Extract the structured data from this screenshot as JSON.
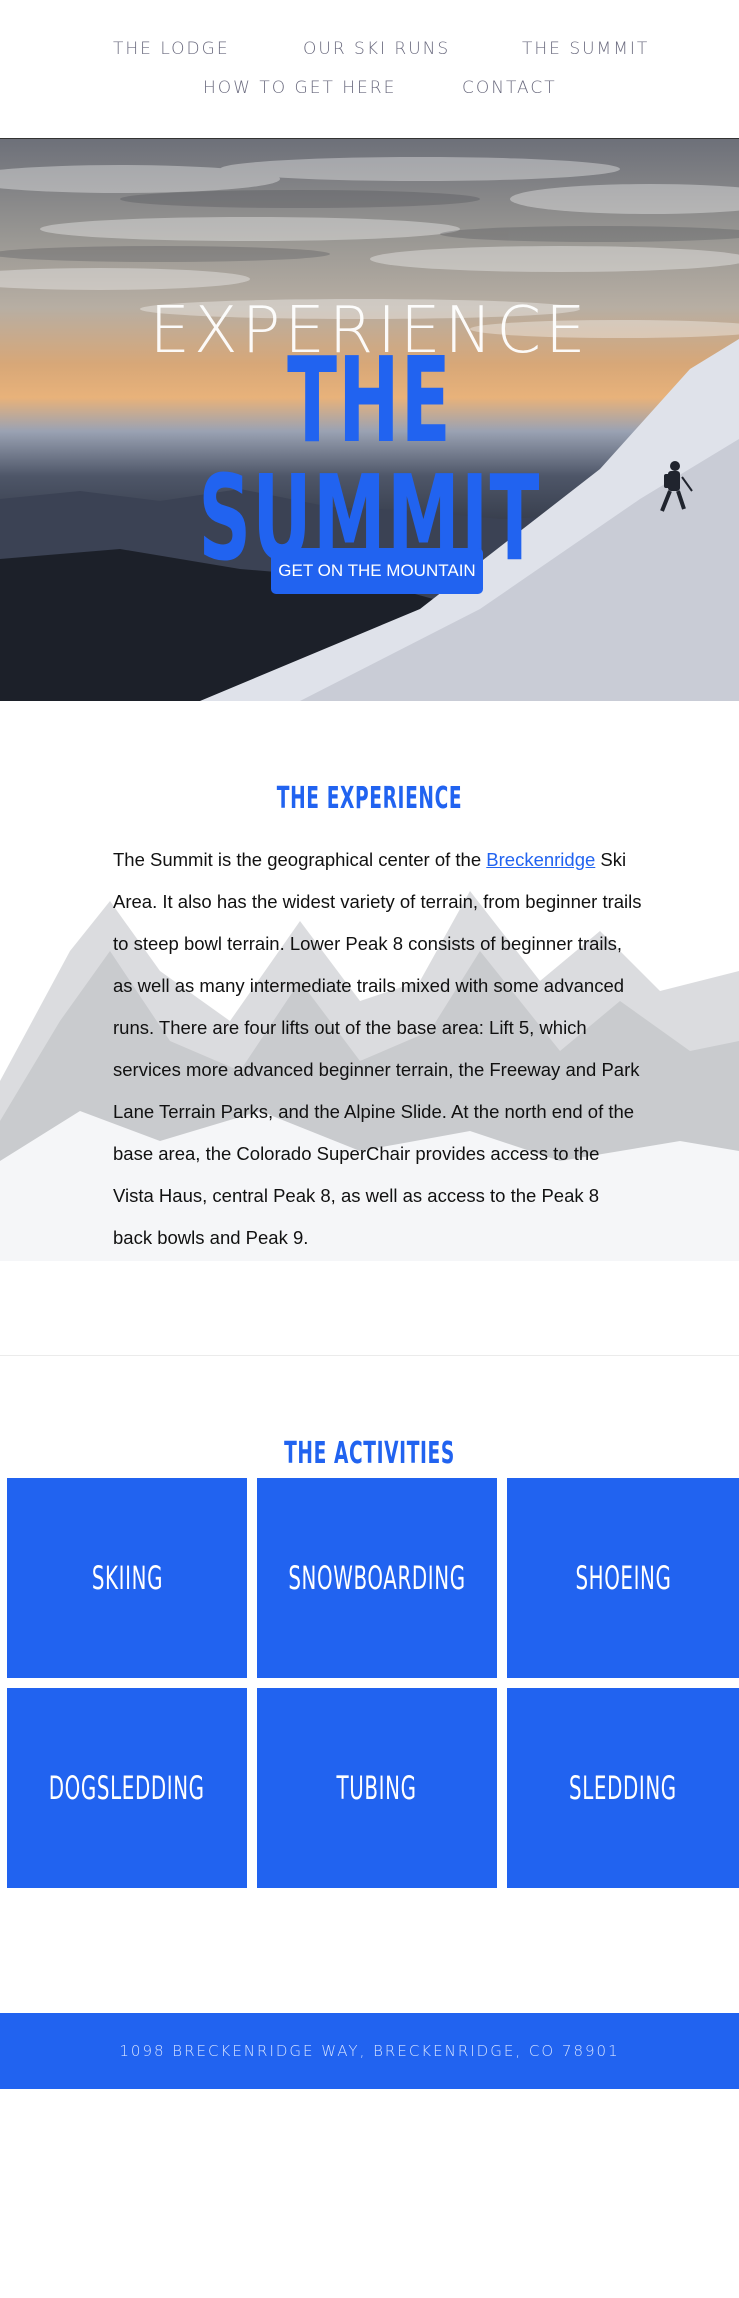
{
  "nav": {
    "items": [
      {
        "label": "THE LODGE"
      },
      {
        "label": "OUR SKI RUNS"
      },
      {
        "label": "THE SUMMIT"
      },
      {
        "label": "HOW TO GET HERE"
      },
      {
        "label": "CONTACT"
      }
    ]
  },
  "hero": {
    "title_line1": "EXPERIENCE",
    "title_line2": "THE SUMMIT",
    "cta_label": "GET ON THE MOUNTAIN"
  },
  "experience": {
    "title": "THE EXPERIENCE",
    "text_before": "The Summit is the geographical center of the ",
    "link_text": "Breckenridge",
    "text_after": " Ski Area. It also has the widest variety of terrain, from beginner trails to steep bowl terrain. Lower Peak 8 consists of beginner trails, as well as many intermediate trails mixed with some advanced runs. There are four lifts out of the base area: Lift 5, which services more advanced beginner terrain, the Freeway and Park Lane Terrain Parks, and the Alpine Slide. At the north end of the base area, the Colorado SuperChair provides access to the Vista Haus, central Peak 8, as well as access to the Peak 8 back bowls and Peak 9."
  },
  "activities": {
    "title": "THE ACTIVITIES",
    "items": [
      {
        "label": "SKIING"
      },
      {
        "label": "SNOWBOARDING"
      },
      {
        "label": "SHOEING"
      },
      {
        "label": "DOGSLEDDING"
      },
      {
        "label": "TUBING"
      },
      {
        "label": "SLEDDING"
      }
    ]
  },
  "footer": {
    "address": "1098 BRECKENRIDGE WAY, BRECKENRIDGE, CO 78901"
  },
  "colors": {
    "accent": "#2163f0",
    "nav_text": "#6b6b7f"
  }
}
